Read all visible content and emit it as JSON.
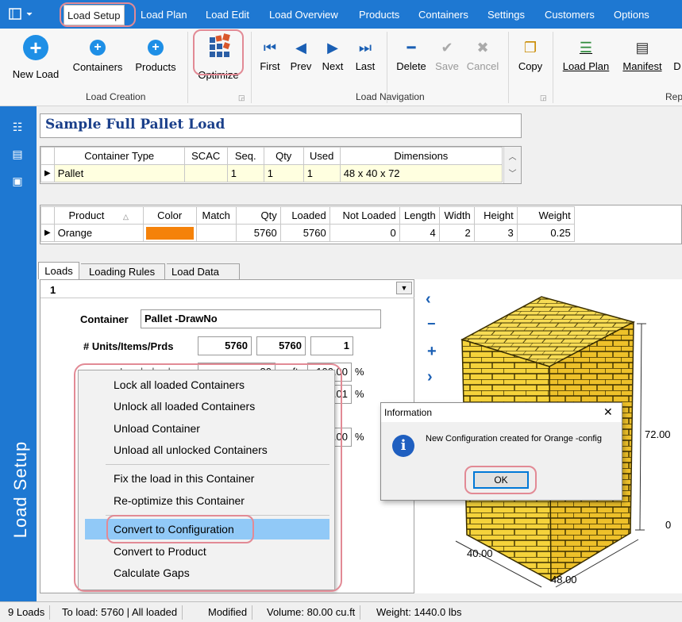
{
  "menubar": {
    "tabs": [
      "Load Setup",
      "Load Plan",
      "Load Edit",
      "Load Overview",
      "Products",
      "Containers",
      "Settings",
      "Customers",
      "Options"
    ],
    "active_tab": "Load Setup"
  },
  "ribbon": {
    "new_load": "New Load",
    "containers": "Containers",
    "products": "Products",
    "optimize": "Optimize",
    "first": "First",
    "prev": "Prev",
    "next": "Next",
    "last": "Last",
    "delete": "Delete",
    "save": "Save",
    "cancel": "Cancel",
    "copy": "Copy",
    "load_plan": "Load Plan",
    "manifest": "Manifest",
    "d_cut": "D",
    "group_load_creation": "Load Creation",
    "group_load_navigation": "Load Navigation",
    "group_rep_cut": "Rep"
  },
  "rail": {
    "title": "Load Setup"
  },
  "load_title": "Sample Full Pallet Load",
  "container_grid": {
    "headers": [
      "Container Type",
      "SCAC",
      "Seq.",
      "Qty",
      "Used",
      "Dimensions"
    ],
    "rows": [
      [
        "Pallet",
        "",
        "1",
        "1",
        "1",
        "48 x 40 x 72"
      ]
    ]
  },
  "product_grid": {
    "headers": [
      "Product",
      "Color",
      "Match",
      "Qty",
      "Loaded",
      "Not Loaded",
      "Length",
      "Width",
      "Height",
      "Weight"
    ],
    "rows": [
      [
        "Orange",
        "",
        "",
        "5760",
        "5760",
        "0",
        "4",
        "2",
        "3",
        "0.25"
      ]
    ],
    "swatch_color": "#f5820a"
  },
  "subtabs": [
    "Loads",
    "Loading Rules",
    "Load Data"
  ],
  "load_panel": {
    "load_tab": "1",
    "container_label": "Container",
    "container_value": "Pallet -DrawNo",
    "units_label": "# Units/Items/Prds",
    "units_values": [
      "5760",
      "5760",
      "1"
    ],
    "loaded_volume_label": "Loaded volume",
    "volume_value": "80",
    "volume_unit": "cu.ft",
    "pct_values": [
      "100.00",
      "100.01",
      "100.00"
    ],
    "pct_sign": "%"
  },
  "context_menu": {
    "items": [
      "Lock all loaded Containers",
      "Unlock all loaded Containers",
      "Unload Container",
      "Unload all unlocked Containers",
      "Fix the load in this Container",
      "Re-optimize this Container",
      "Convert to Configuration",
      "Convert to Product",
      "Calculate Gaps"
    ],
    "selected": "Convert to Configuration"
  },
  "dialog": {
    "title": "Information",
    "message": "New Configuration created for Orange -config",
    "ok": "OK",
    "close": "✕"
  },
  "render3d": {
    "height_label": "72.00",
    "zero_label": "0",
    "width_label": "40.00",
    "depth_label": "48.00"
  },
  "statusbar": {
    "loads": "9 Loads",
    "summary": "To load: 5760  |  All loaded",
    "state": "Modified",
    "volume": "Volume: 80.00 cu.ft",
    "weight": "Weight: 1440.0 lbs"
  },
  "colors": {
    "accent": "#1e78d2",
    "highlight": "#e28a95",
    "box": "#f5d33b"
  }
}
